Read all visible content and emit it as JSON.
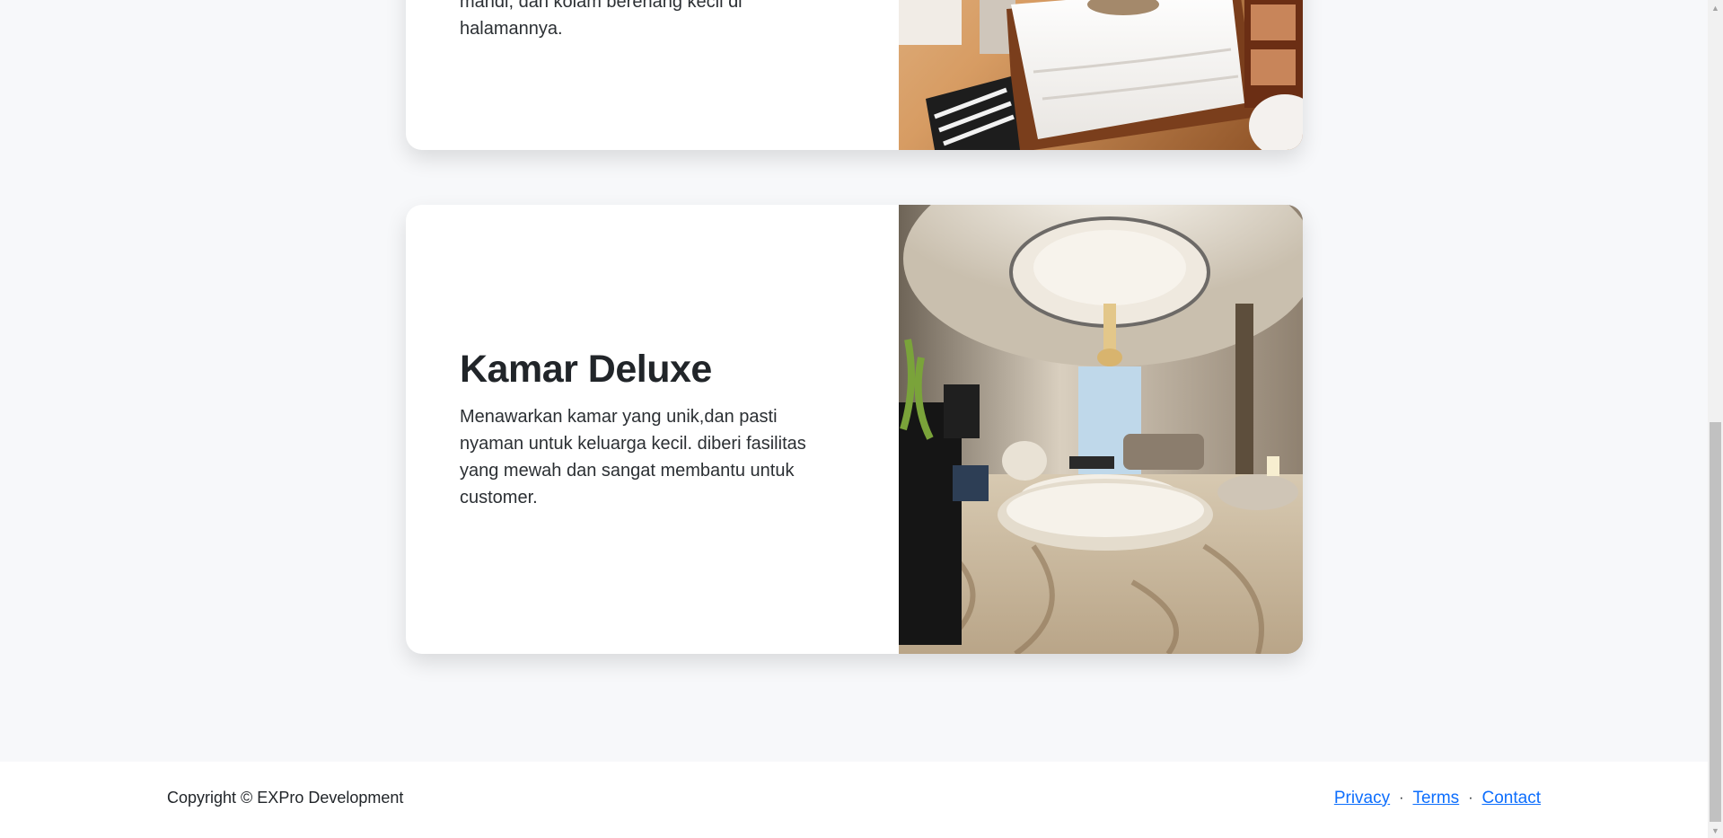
{
  "rooms": [
    {
      "title": "",
      "description": "mandi, dan kolam berenang kecil di halamannya."
    },
    {
      "title": "Kamar Deluxe",
      "description": "Menawarkan kamar yang unik,dan pasti nyaman untuk keluarga kecil. diberi fasilitas yang mewah dan sangat membantu untuk customer."
    }
  ],
  "footer": {
    "copyright": "Copyright © EXPro Development",
    "links": [
      "Privacy",
      "Terms",
      "Contact"
    ],
    "separator": "·"
  },
  "colors": {
    "link": "#0d6efd",
    "background": "#f7f8fa"
  }
}
